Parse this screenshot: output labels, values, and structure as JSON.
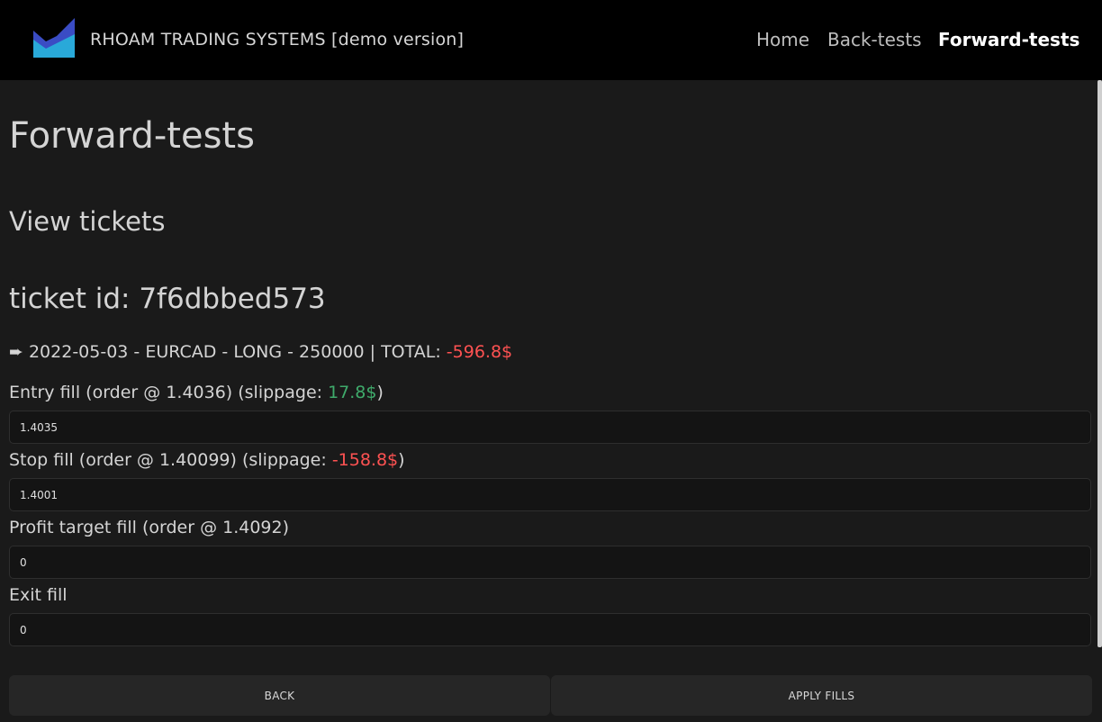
{
  "header": {
    "brand": "RHOAM TRADING SYSTEMS [demo version]",
    "logo_icon": "area-chart-logo-icon",
    "nav": {
      "home": "Home",
      "backtests": "Back-tests",
      "forwardtests": "Forward-tests"
    },
    "active_nav": "forwardtests"
  },
  "page": {
    "title": "Forward-tests",
    "section_title": "View tickets",
    "ticket_id_label": "ticket id: 7f6dbbed573"
  },
  "ticket": {
    "prefix_icon": "➨",
    "summary": "2022-05-03 - EURCAD - LONG - 250000 | TOTAL: ",
    "total": "-596.8$"
  },
  "fields": {
    "entry": {
      "label_prefix": "Entry fill (order @ 1.4036) (slippage: ",
      "slippage": "17.8$",
      "label_suffix": ")",
      "value": "1.4035"
    },
    "stop": {
      "label_prefix": "Stop fill (order @ 1.40099) (slippage: ",
      "slippage": "-158.8$",
      "label_suffix": ")",
      "value": "1.4001"
    },
    "profit": {
      "label": "Profit target fill (order @ 1.4092)",
      "value": "0"
    },
    "exit": {
      "label": "Exit fill",
      "value": "0"
    }
  },
  "buttons": {
    "back": "Back",
    "apply": "Apply fills"
  },
  "colors": {
    "background": "#1a1a1a",
    "navbar": "#000000",
    "negative": "#ff5252",
    "positive": "#3faa6b",
    "logo_dark": "#3a4cc4",
    "logo_light": "#29a9d9"
  }
}
